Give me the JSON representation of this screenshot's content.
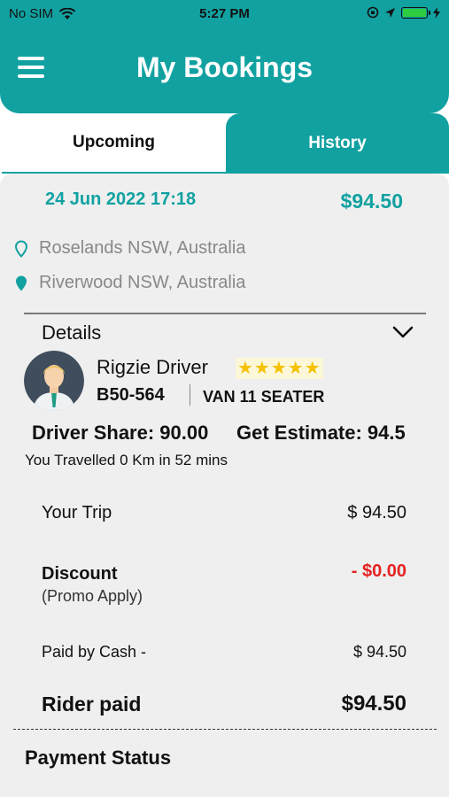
{
  "status_bar": {
    "carrier": "No SIM",
    "time": "5:27 PM"
  },
  "header": {
    "title": "My Bookings"
  },
  "tabs": [
    {
      "label": "Upcoming"
    },
    {
      "label": "History"
    }
  ],
  "booking": {
    "datetime": "24 Jun 2022 17:18",
    "price": "$94.50",
    "pickup": "Roselands NSW, Australia",
    "dropoff": "Riverwood NSW, Australia",
    "details_label": "Details",
    "driver": {
      "name": "Rigzie Driver",
      "rating_stars": "★★★★★",
      "rating": 5,
      "plate": "B50-564",
      "vehicle": "VAN 11 SEATER"
    },
    "driver_share": "Driver Share: 90.00",
    "estimate": "Get Estimate: 94.5",
    "travelled": "You Travelled 0 Km in 52 mins",
    "your_trip_label": "Your Trip",
    "your_trip_value": "$ 94.50",
    "discount_label": "Discount",
    "promo_label": "(Promo Apply)",
    "discount_value": "- $0.00",
    "cash_label": "Paid by Cash -",
    "cash_value": "$ 94.50",
    "rider_paid_label": "Rider paid",
    "rider_paid_value": "$94.50",
    "payment_status_label": "Payment Status"
  },
  "colors": {
    "accent": "#12a1a1",
    "discount": "#e52222",
    "stars": "#f5c100"
  },
  "icons": [
    "menu-icon",
    "wifi-icon",
    "location-arrow-icon",
    "battery-icon",
    "pin-outline-icon",
    "pin-filled-icon",
    "chevron-down-icon",
    "avatar-icon"
  ]
}
